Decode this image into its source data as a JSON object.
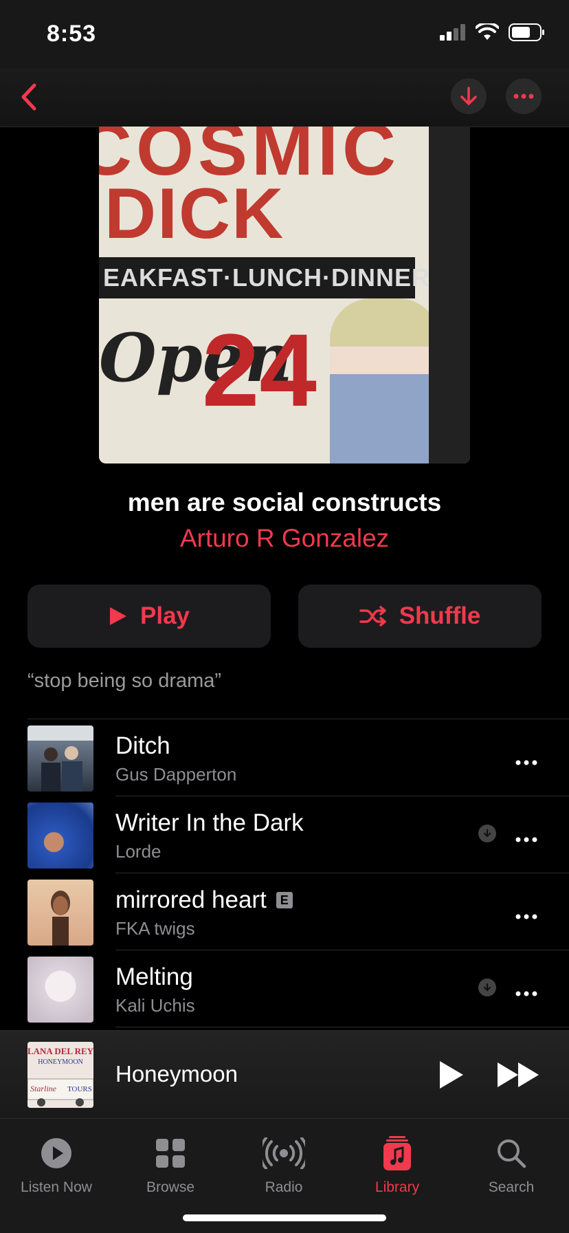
{
  "status": {
    "time": "8:53"
  },
  "nav": {
    "back": "back",
    "download": "download",
    "more": "more"
  },
  "album": {
    "art_text": {
      "line1": "COSMIC",
      "line2": "DICK",
      "band": "EAKFAST·LUNCH·DINNER",
      "open": "Open",
      "hours": "24"
    },
    "title": "men are social constructs",
    "artist": "Arturo R Gonzalez"
  },
  "actions": {
    "play": "Play",
    "shuffle": "Shuffle"
  },
  "description": "“stop being so drama”",
  "tracks": [
    {
      "title": "Ditch",
      "artist": "Gus Dapperton",
      "explicit": false,
      "downloaded": false
    },
    {
      "title": "Writer In the Dark",
      "artist": "Lorde",
      "explicit": false,
      "downloaded": true
    },
    {
      "title": "mirrored heart",
      "artist": "FKA twigs",
      "explicit": true,
      "explicit_badge": "E",
      "downloaded": false
    },
    {
      "title": "Melting",
      "artist": "Kali Uchis",
      "explicit": false,
      "downloaded": true
    }
  ],
  "now_playing": {
    "title": "Honeymoon",
    "art_text": [
      "LANA DEL REY",
      "HONEYMOON",
      "Starline",
      "TOURS"
    ]
  },
  "tabs": [
    {
      "label": "Listen Now",
      "icon": "play-circle-icon",
      "active": false
    },
    {
      "label": "Browse",
      "icon": "grid-icon",
      "active": false
    },
    {
      "label": "Radio",
      "icon": "radio-icon",
      "active": false
    },
    {
      "label": "Library",
      "icon": "music-note-icon",
      "active": true
    },
    {
      "label": "Search",
      "icon": "search-icon",
      "active": false
    }
  ],
  "colors": {
    "accent": "#f2394d",
    "background": "#000000",
    "secondary_text": "#8e8e93"
  }
}
